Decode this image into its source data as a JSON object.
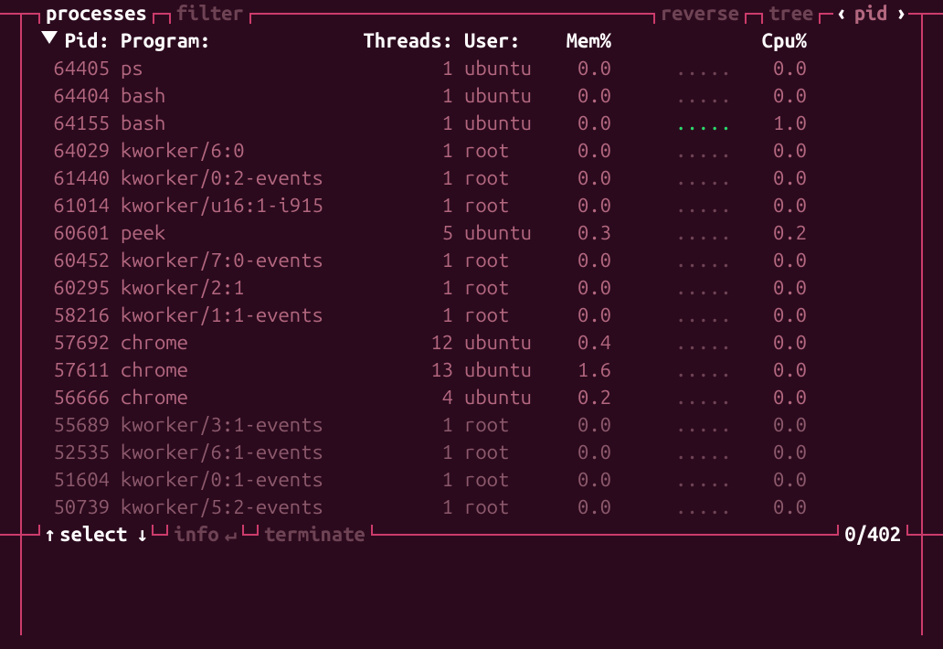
{
  "top": {
    "tabs": [
      "processes",
      "filter"
    ],
    "buttons": [
      "reverse",
      "tree"
    ],
    "sort_prev": "‹",
    "sort_col": "pid",
    "sort_next": "›"
  },
  "headers": {
    "pid": "Pid:",
    "program": "Program:",
    "threads": "Threads:",
    "user": "User:",
    "mem": "Mem%",
    "cpu": "Cpu%"
  },
  "rows": [
    {
      "pid": "64405",
      "program": "ps",
      "threads": "1",
      "user": "ubuntu",
      "mem": "0.0",
      "mgraph": "",
      "cgraph": ".....",
      "cpu": "0.0",
      "dim": false,
      "green": false
    },
    {
      "pid": "64404",
      "program": "bash",
      "threads": "1",
      "user": "ubuntu",
      "mem": "0.0",
      "mgraph": "",
      "cgraph": ".....",
      "cpu": "0.0",
      "dim": false,
      "green": false
    },
    {
      "pid": "64155",
      "program": "bash",
      "threads": "1",
      "user": "ubuntu",
      "mem": "0.0",
      "mgraph": "",
      "cgraph": ".....",
      "cpu": "1.0",
      "dim": false,
      "green": true
    },
    {
      "pid": "64029",
      "program": "kworker/6:0",
      "threads": "1",
      "user": "root",
      "mem": "0.0",
      "mgraph": "",
      "cgraph": ".....",
      "cpu": "0.0",
      "dim": false,
      "green": false
    },
    {
      "pid": "61440",
      "program": "kworker/0:2-events",
      "threads": "1",
      "user": "root",
      "mem": "0.0",
      "mgraph": "",
      "cgraph": ".....",
      "cpu": "0.0",
      "dim": false,
      "green": false
    },
    {
      "pid": "61014",
      "program": "kworker/u16:1-i915",
      "threads": "1",
      "user": "root",
      "mem": "0.0",
      "mgraph": "",
      "cgraph": ".....",
      "cpu": "0.0",
      "dim": false,
      "green": false
    },
    {
      "pid": "60601",
      "program": "peek",
      "threads": "5",
      "user": "ubuntu",
      "mem": "0.3",
      "mgraph": "",
      "cgraph": ".....",
      "cpu": "0.2",
      "dim": false,
      "green": false
    },
    {
      "pid": "60452",
      "program": "kworker/7:0-events",
      "threads": "1",
      "user": "root",
      "mem": "0.0",
      "mgraph": "",
      "cgraph": ".....",
      "cpu": "0.0",
      "dim": false,
      "green": false
    },
    {
      "pid": "60295",
      "program": "kworker/2:1",
      "threads": "1",
      "user": "root",
      "mem": "0.0",
      "mgraph": "",
      "cgraph": ".....",
      "cpu": "0.0",
      "dim": false,
      "green": false
    },
    {
      "pid": "58216",
      "program": "kworker/1:1-events",
      "threads": "1",
      "user": "root",
      "mem": "0.0",
      "mgraph": "",
      "cgraph": ".....",
      "cpu": "0.0",
      "dim": false,
      "green": false
    },
    {
      "pid": "57692",
      "program": "chrome",
      "threads": "12",
      "user": "ubuntu",
      "mem": "0.4",
      "mgraph": "",
      "cgraph": ".....",
      "cpu": "0.0",
      "dim": false,
      "green": false
    },
    {
      "pid": "57611",
      "program": "chrome",
      "threads": "13",
      "user": "ubuntu",
      "mem": "1.6",
      "mgraph": "",
      "cgraph": ".....",
      "cpu": "0.0",
      "dim": false,
      "green": false
    },
    {
      "pid": "56666",
      "program": "chrome",
      "threads": "4",
      "user": "ubuntu",
      "mem": "0.2",
      "mgraph": "",
      "cgraph": ".....",
      "cpu": "0.0",
      "dim": false,
      "green": false
    },
    {
      "pid": "55689",
      "program": "kworker/3:1-events",
      "threads": "1",
      "user": "root",
      "mem": "0.0",
      "mgraph": "",
      "cgraph": ".....",
      "cpu": "0.0",
      "dim": true,
      "green": false
    },
    {
      "pid": "52535",
      "program": "kworker/6:1-events",
      "threads": "1",
      "user": "root",
      "mem": "0.0",
      "mgraph": "",
      "cgraph": ".....",
      "cpu": "0.0",
      "dim": true,
      "green": false
    },
    {
      "pid": "51604",
      "program": "kworker/0:1-events",
      "threads": "1",
      "user": "root",
      "mem": "0.0",
      "mgraph": "",
      "cgraph": ".....",
      "cpu": "0.0",
      "dim": true,
      "green": false
    },
    {
      "pid": "50739",
      "program": "kworker/5:2-events",
      "threads": "1",
      "user": "root",
      "mem": "0.0",
      "mgraph": "",
      "cgraph": ".....",
      "cpu": "0.0",
      "dim": true,
      "green": false
    }
  ],
  "bottom": {
    "select_up": "↑",
    "select_label": "select",
    "select_down": "↓",
    "info_label": "info",
    "info_key": "↵",
    "terminate_label": "terminate",
    "status": "0/402"
  }
}
